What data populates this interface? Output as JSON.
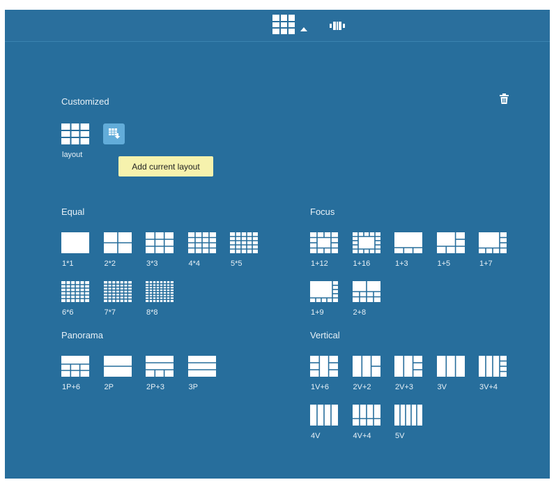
{
  "toolbar": {
    "layout_icon": "grid-layout-icon",
    "dropdown_icon": "caret-up-icon",
    "rotate_icon": "carousel-icon"
  },
  "customized": {
    "title": "Customized",
    "saved_layout_label": "layout",
    "add_tooltip": "Add current layout",
    "delete_icon": "trash-icon"
  },
  "sections": {
    "equal": {
      "title": "Equal",
      "items": [
        "1*1",
        "2*2",
        "3*3",
        "4*4",
        "5*5",
        "6*6",
        "7*7",
        "8*8"
      ]
    },
    "focus": {
      "title": "Focus",
      "items": [
        "1+12",
        "1+16",
        "1+3",
        "1+5",
        "1+7",
        "1+9",
        "2+8"
      ]
    },
    "panorama": {
      "title": "Panorama",
      "items": [
        "1P+6",
        "2P",
        "2P+3",
        "3P"
      ]
    },
    "vertical": {
      "title": "Vertical",
      "items": [
        "1V+6",
        "2V+2",
        "2V+3",
        "3V",
        "3V+4",
        "4V",
        "4V+4",
        "5V"
      ]
    }
  },
  "colors": {
    "background": "#276e9c",
    "tile": "#ffffff",
    "tooltip": "#f6f2ad",
    "add_button": "#62acd9"
  }
}
